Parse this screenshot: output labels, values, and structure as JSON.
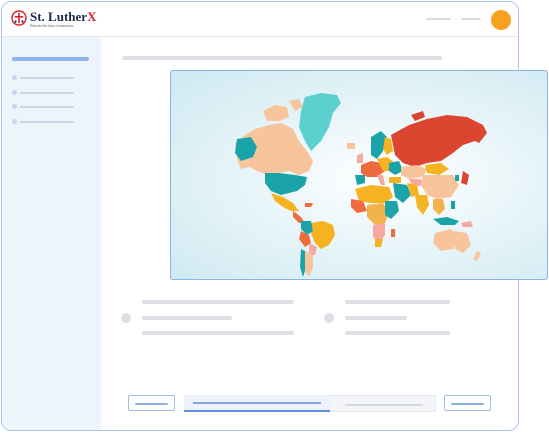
{
  "brand": {
    "name": "St. Luther",
    "name_accent": "X",
    "tagline": "Educate the class of tomorrow"
  },
  "header": {
    "avatar_color": "#f7a21c"
  },
  "colors": {
    "window_border": "#a9c4f0",
    "sidebar_bg": "#eef4fb",
    "accent": "#5f8fd9",
    "map_card_border": "#8fb2e6"
  },
  "icons": [
    "logo-crest-icon",
    "avatar-icon"
  ],
  "map": {
    "description_hidden": false,
    "region_colors": {
      "north_america": "#f7c49b",
      "usa": "#1aa3a8",
      "greenland": "#5ccfcf",
      "latin_america": "#f5b221",
      "south_america_west": "#ea6f3d",
      "europe": "#ef6b3f",
      "russia": "#dc4530",
      "asia_misc": "#f3b34b",
      "africa": "#f5b221",
      "oceania": "#f7c49b",
      "teal": "#1aa3a8",
      "pink": "#f7a8a0"
    }
  },
  "pagination": {
    "progress": 0.58
  }
}
